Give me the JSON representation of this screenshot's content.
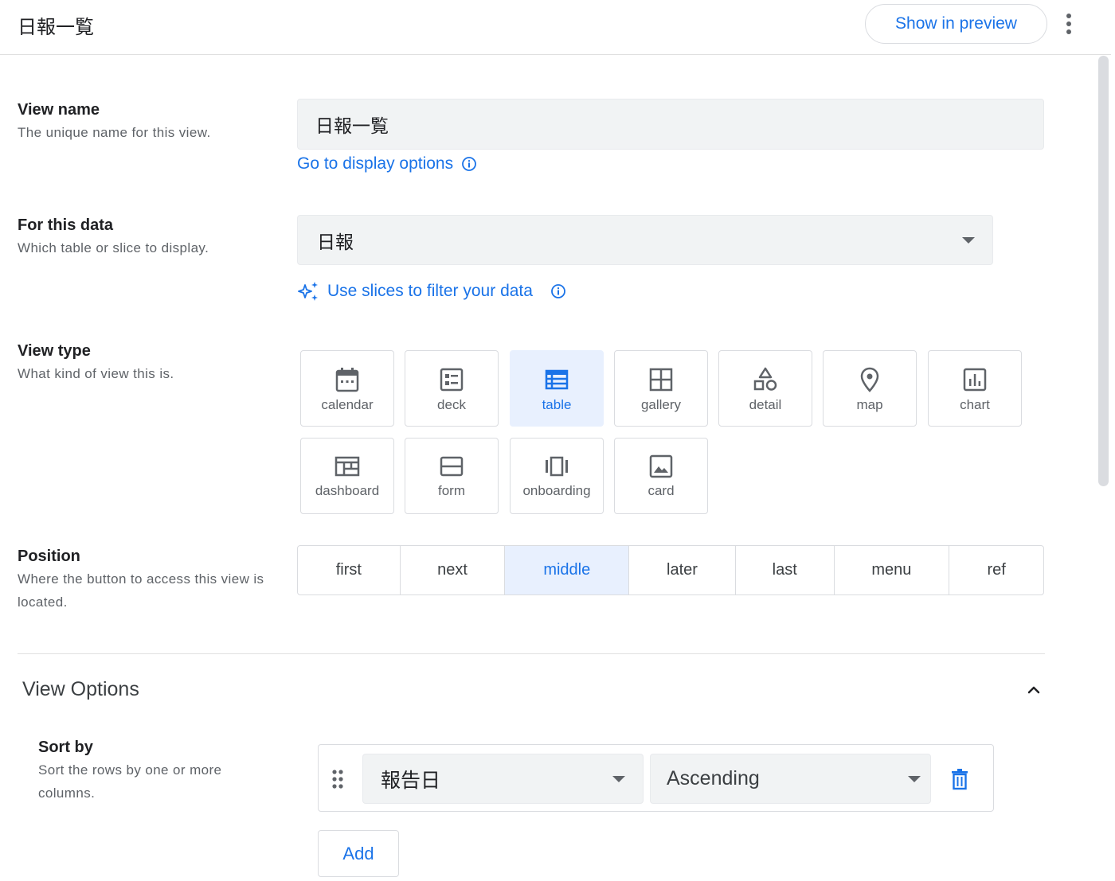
{
  "header": {
    "title": "日報一覧",
    "preview_label": "Show in preview"
  },
  "view_name": {
    "title": "View name",
    "description": "The unique name for this view.",
    "value": "日報一覧",
    "display_options_link": "Go to display options"
  },
  "for_this_data": {
    "title": "For this data",
    "description": "Which table or slice to display.",
    "selected": "日報",
    "slices_link": "Use slices to filter your data"
  },
  "view_type": {
    "title": "View type",
    "description": "What kind of view this is.",
    "options": [
      {
        "label": "calendar",
        "icon": "calendar-icon"
      },
      {
        "label": "deck",
        "icon": "deck-icon"
      },
      {
        "label": "table",
        "icon": "table-icon"
      },
      {
        "label": "gallery",
        "icon": "gallery-icon"
      },
      {
        "label": "detail",
        "icon": "detail-icon"
      },
      {
        "label": "map",
        "icon": "map-pin-icon"
      },
      {
        "label": "chart",
        "icon": "chart-icon"
      },
      {
        "label": "dashboard",
        "icon": "dashboard-icon"
      },
      {
        "label": "form",
        "icon": "form-icon"
      },
      {
        "label": "onboarding",
        "icon": "onboarding-icon"
      },
      {
        "label": "card",
        "icon": "card-image-icon"
      }
    ],
    "selected": "table"
  },
  "position": {
    "title": "Position",
    "description": "Where the button to access this view is located.",
    "options": [
      "first",
      "next",
      "middle",
      "later",
      "last",
      "menu",
      "ref"
    ],
    "selected": "middle"
  },
  "view_options": {
    "title": "View Options",
    "sort_by": {
      "title": "Sort by",
      "description": "Sort the rows by one or more columns.",
      "column": "報告日",
      "direction": "Ascending"
    },
    "add_label": "Add"
  },
  "colors": {
    "accent": "#1a73e8",
    "selected_bg": "#e8f0fe",
    "field_bg": "#f1f3f4",
    "border": "#dadce0"
  }
}
